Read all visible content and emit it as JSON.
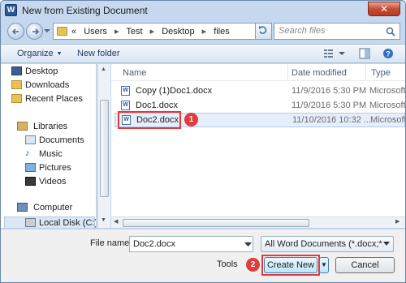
{
  "window": {
    "title": "New from Existing Document",
    "app_icon": "W",
    "close_symbol": "✕"
  },
  "address": {
    "crumbs": [
      "«",
      "Users",
      "Test",
      "Desktop",
      "files"
    ],
    "separator": "▸"
  },
  "search": {
    "placeholder": "Search files"
  },
  "toolbar": {
    "organize_label": "Organize",
    "new_folder_label": "New folder"
  },
  "nav": {
    "favorites": [
      "Desktop",
      "Downloads",
      "Recent Places"
    ],
    "libraries_label": "Libraries",
    "libraries": [
      "Documents",
      "Music",
      "Pictures",
      "Videos"
    ],
    "computer_label": "Computer",
    "drives": [
      "Local Disk (C:)"
    ]
  },
  "columns": {
    "name": "Name",
    "date": "Date modified",
    "type": "Type"
  },
  "files": [
    {
      "name": "Copy (1)Doc1.docx",
      "date": "11/9/2016 5:30 PM",
      "type": "Microsoft"
    },
    {
      "name": "Doc1.docx",
      "date": "11/9/2016 5:30 PM",
      "type": "Microsoft"
    },
    {
      "name": "Doc2.docx",
      "date": "11/10/2016 10:32 ...",
      "type": "Microsoft",
      "selected": true
    }
  ],
  "annotations": {
    "step1": "1",
    "step2": "2",
    "highlight_color": "#e03b3b"
  },
  "bottom": {
    "file_name_label": "File name:",
    "file_name_value": "Doc2.docx",
    "filter_value": "All Word Documents (*.docx;*.doc",
    "tools_label": "Tools",
    "create_label": "Create New",
    "cancel_label": "Cancel"
  }
}
